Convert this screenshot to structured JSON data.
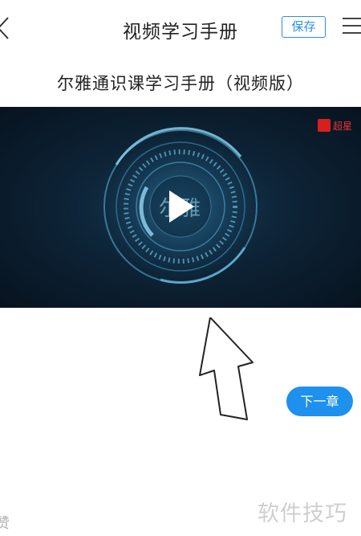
{
  "header": {
    "title": "视频学习手册",
    "save_label": "保存"
  },
  "document": {
    "title": "尔雅通识课学习手册（视频版）"
  },
  "video": {
    "center_text": "尔雅",
    "logo_text": "超星"
  },
  "actions": {
    "next_chapter": "下一章"
  },
  "footer": {
    "like_text": "赞",
    "watermark": "软件技巧"
  },
  "icons": {
    "back": "chevron-left-icon",
    "menu": "hamburger-icon",
    "play": "play-icon",
    "arrow": "up-arrow-icon"
  },
  "colors": {
    "accent": "#1e90ee",
    "video_bg": "#0d2336",
    "video_glow": "#4fc3f7"
  }
}
